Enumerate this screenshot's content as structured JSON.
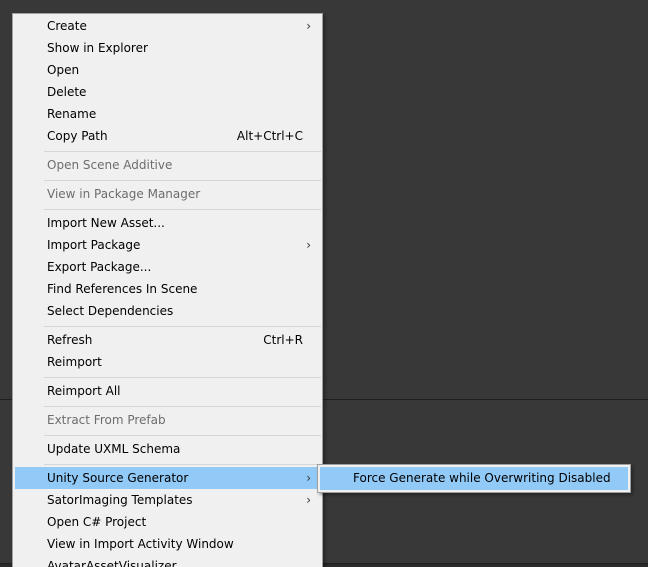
{
  "menu": {
    "items": [
      {
        "label": "Create",
        "submenu": true
      },
      {
        "label": "Show in Explorer"
      },
      {
        "label": "Open"
      },
      {
        "label": "Delete"
      },
      {
        "label": "Rename"
      },
      {
        "label": "Copy Path",
        "shortcut": "Alt+Ctrl+C"
      },
      {
        "label": "Open Scene Additive",
        "disabled": true
      },
      {
        "label": "View in Package Manager",
        "disabled": true
      },
      {
        "label": "Import New Asset..."
      },
      {
        "label": "Import Package",
        "submenu": true
      },
      {
        "label": "Export Package..."
      },
      {
        "label": "Find References In Scene"
      },
      {
        "label": "Select Dependencies"
      },
      {
        "label": "Refresh",
        "shortcut": "Ctrl+R"
      },
      {
        "label": "Reimport"
      },
      {
        "label": "Reimport All"
      },
      {
        "label": "Extract From Prefab",
        "disabled": true
      },
      {
        "label": "Update UXML Schema"
      },
      {
        "label": "Unity Source Generator",
        "submenu": true,
        "highlighted": true
      },
      {
        "label": "SatorImaging Templates",
        "submenu": true
      },
      {
        "label": "Open C# Project"
      },
      {
        "label": "View in Import Activity Window"
      },
      {
        "label": "AvatarAssetVisualizer"
      }
    ],
    "submenu_arrow": "›"
  },
  "submenu": {
    "items": [
      {
        "label": "Force Generate while Overwriting Disabled",
        "highlighted": true
      }
    ]
  },
  "colors": {
    "background": "#383838",
    "menu_background": "#f0f0f0",
    "highlight": "#91c9f7",
    "disabled_text": "#6d6d6d"
  }
}
